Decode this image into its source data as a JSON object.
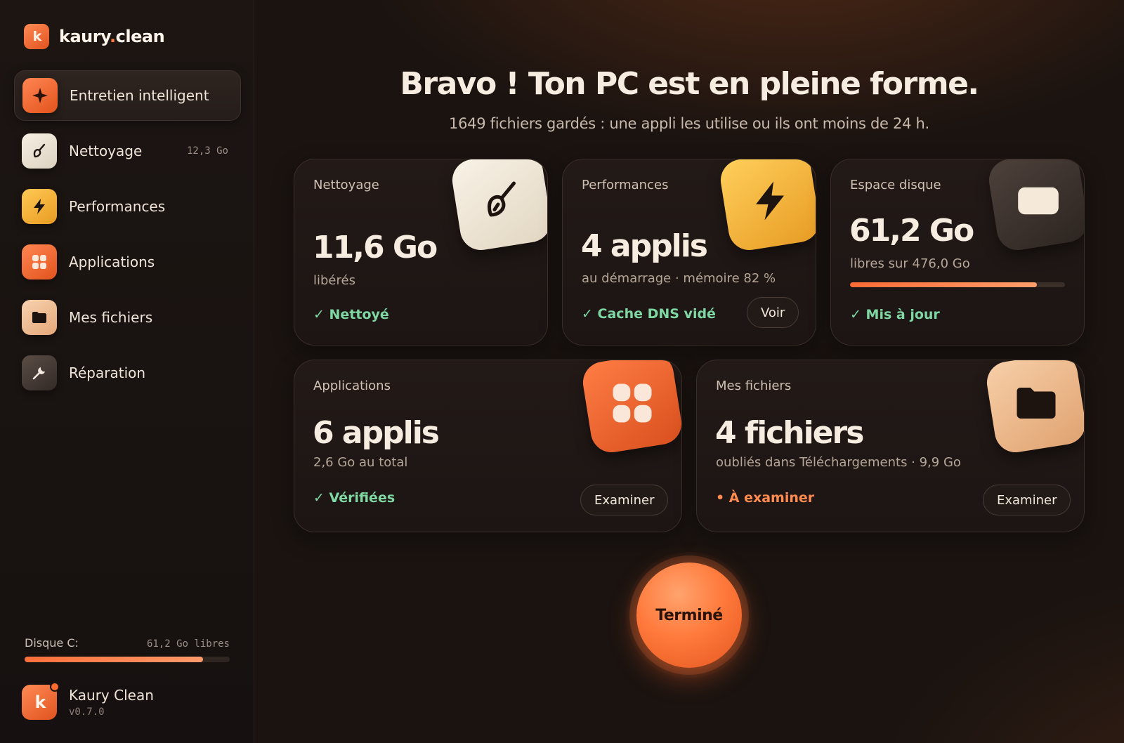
{
  "brand": {
    "name_main": "kaury",
    "name_dot": ".",
    "name_end": "clean",
    "logo_text": "k"
  },
  "sidebar": {
    "items": [
      {
        "label": "Entretien intelligent",
        "icon": "sparkle-icon",
        "badge": ""
      },
      {
        "label": "Nettoyage",
        "icon": "brush-icon",
        "badge": "12,3 Go"
      },
      {
        "label": "Performances",
        "icon": "bolt-icon",
        "badge": ""
      },
      {
        "label": "Applications",
        "icon": "apps-grid-icon",
        "badge": ""
      },
      {
        "label": "Mes fichiers",
        "icon": "folder-icon",
        "badge": ""
      },
      {
        "label": "Réparation",
        "icon": "wrench-icon",
        "badge": ""
      }
    ],
    "active_index": 0,
    "disk": {
      "label": "Disque C:",
      "value": "61,2 Go libres",
      "used_fraction": 0.87
    },
    "profile": {
      "name": "Kaury Clean",
      "version": "v0.7.0",
      "avatar_text": "k"
    }
  },
  "main": {
    "headline": "Bravo ! Ton PC est en pleine forme.",
    "subline": "1649 fichiers gardés : une appli les utilise ou ils ont moins de 24 h.",
    "cards": {
      "cleaning": {
        "title": "Nettoyage",
        "value": "11,6 Go",
        "sub": "libérés",
        "status": "✓ Nettoyé"
      },
      "performance": {
        "title": "Performances",
        "value": "4 applis",
        "sub": "au démarrage · mémoire 82 %",
        "status": "✓ Cache DNS vidé",
        "button": "Voir"
      },
      "disk": {
        "title": "Espace disque",
        "value": "61,2 Go",
        "sub": "libres sur 476,0 Go",
        "status": "✓ Mis à jour",
        "used_fraction": 0.87
      },
      "apps": {
        "title": "Applications",
        "value": "6 applis",
        "sub": "2,6 Go au total",
        "status": "✓ Vérifiées",
        "button": "Examiner"
      },
      "files": {
        "title": "Mes fichiers",
        "value": "4 fichiers",
        "sub": "oubliés dans Téléchargements · 9,9 Go",
        "status": "• À examiner",
        "button": "Examiner"
      }
    },
    "done_button": "Terminé"
  },
  "colors": {
    "accent": "#ff7a3c",
    "success": "#7fd8a3",
    "warning": "#ff8b4f",
    "background": "#1a1310"
  }
}
